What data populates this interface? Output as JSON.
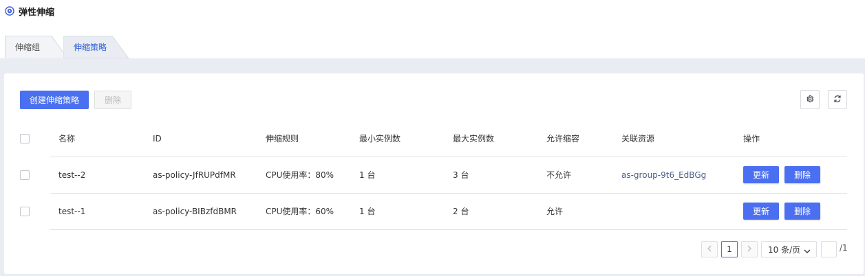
{
  "header": {
    "title": "弹性伸缩",
    "icon": "app-logo-icon"
  },
  "tabs": [
    {
      "label": "伸缩组",
      "active": false
    },
    {
      "label": "伸缩策略",
      "active": true
    }
  ],
  "toolbar": {
    "create_label": "创建伸缩策略",
    "delete_label": "删除",
    "settings_icon": "gear-icon",
    "refresh_icon": "refresh-icon"
  },
  "table": {
    "columns": [
      "名称",
      "ID",
      "伸缩规则",
      "最小实例数",
      "最大实例数",
      "允许缩容",
      "关联资源",
      "操作"
    ],
    "rows": [
      {
        "name": "test--2",
        "id": "as-policy-JfRUPdfMR",
        "rule": "CPU使用率：80%",
        "min": "1 台",
        "max": "3 台",
        "allow_scale_in": "不允许",
        "resource": "as-group-9t6_EdBGg",
        "update_label": "更新",
        "delete_label": "删除"
      },
      {
        "name": "test--1",
        "id": "as-policy-BIBzfdBMR",
        "rule": "CPU使用率：60%",
        "min": "1 台",
        "max": "2 台",
        "allow_scale_in": "允许",
        "resource": "",
        "update_label": "更新",
        "delete_label": "删除"
      }
    ]
  },
  "pagination": {
    "current_page": "1",
    "page_size": "10 条/页",
    "total_pages": "/1"
  },
  "colors": {
    "primary": "#4a6ff0",
    "tab_active": "#2d5fd6",
    "background": "#e9ecf3"
  }
}
